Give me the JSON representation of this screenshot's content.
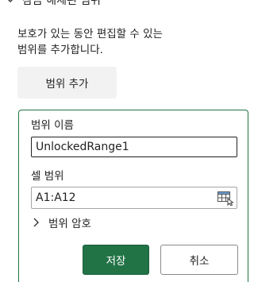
{
  "section": {
    "title": "잠금 해제된 범위"
  },
  "description": {
    "line1": "보호가 있는 동안 편집할 수 있는",
    "line2": "범위를 추가합니다."
  },
  "add_range_button": "범위 추가",
  "form": {
    "name_label": "범위 이름",
    "name_value": "UnlockedRange1",
    "range_label": "셀 범위",
    "range_value": "A1:A12",
    "password_toggle_label": "범위 암호",
    "save_label": "저장",
    "cancel_label": "취소"
  },
  "colors": {
    "accent": "#217346",
    "button_gray": "#f2f2f2"
  },
  "icons": {
    "section_toggle": "chevron-down-icon",
    "range_picker": "range-select-icon",
    "password_toggle": "chevron-right-icon"
  }
}
